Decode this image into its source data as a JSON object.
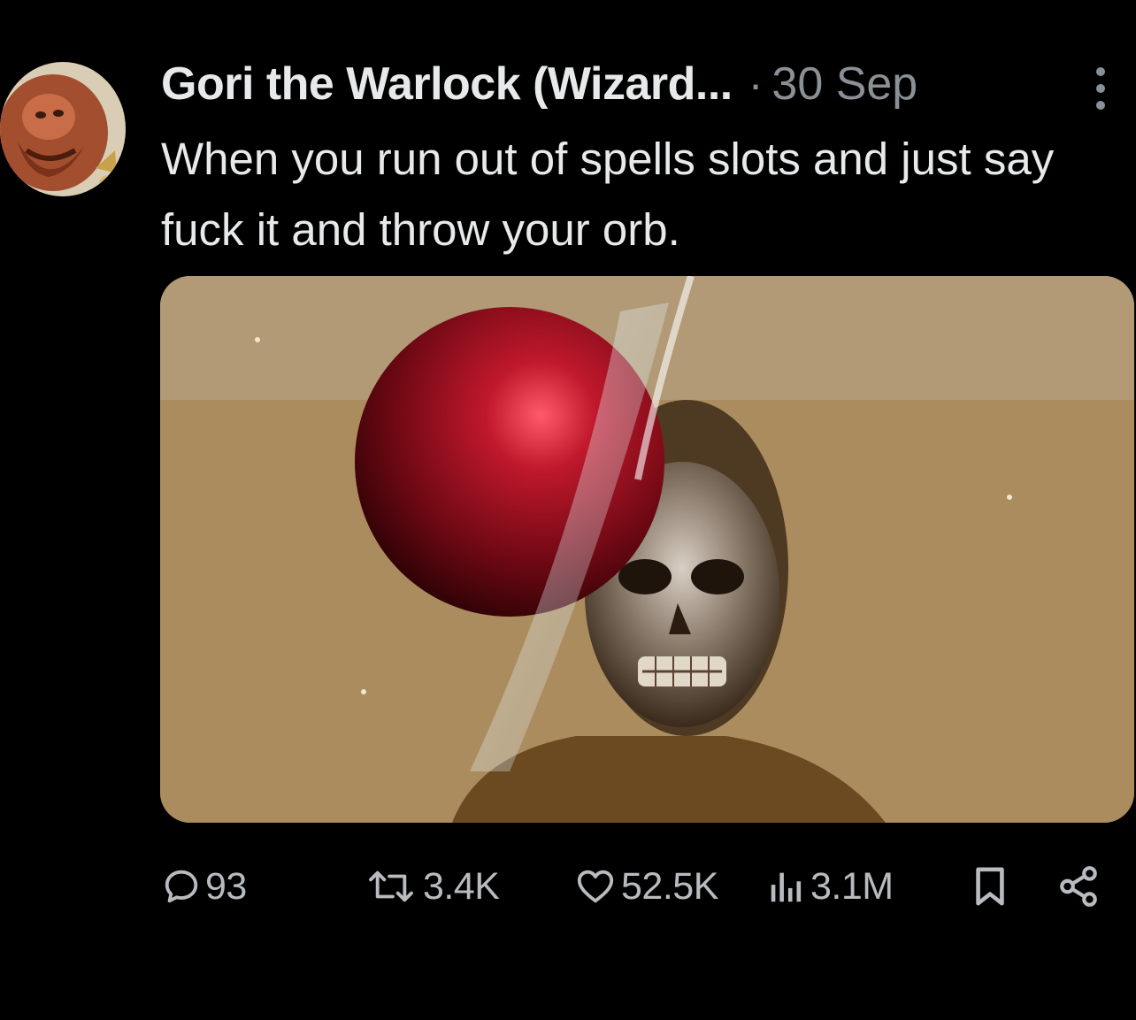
{
  "tweet": {
    "display_name": "Gori the Warlock (Wizard...",
    "separator": "·",
    "timestamp": "30 Sep",
    "text": "When you run out of spells slots and just say fuck it and throw your orb."
  },
  "media": {
    "kind": "image"
  },
  "actions": {
    "replies": "93",
    "retweets": "3.4K",
    "likes": "52.5K",
    "views": "3.1M"
  },
  "icons": {
    "more": "more-vertical-icon",
    "reply": "comment-bubble-icon",
    "retweet": "retweet-icon",
    "like": "heart-icon",
    "views": "bar-chart-icon",
    "bookmark": "bookmark-icon",
    "share": "share-icon"
  },
  "colors": {
    "background": "#000000",
    "text_primary": "#e7e9ea",
    "text_secondary": "#8b9096",
    "action_gray": "#b8bcc0"
  }
}
